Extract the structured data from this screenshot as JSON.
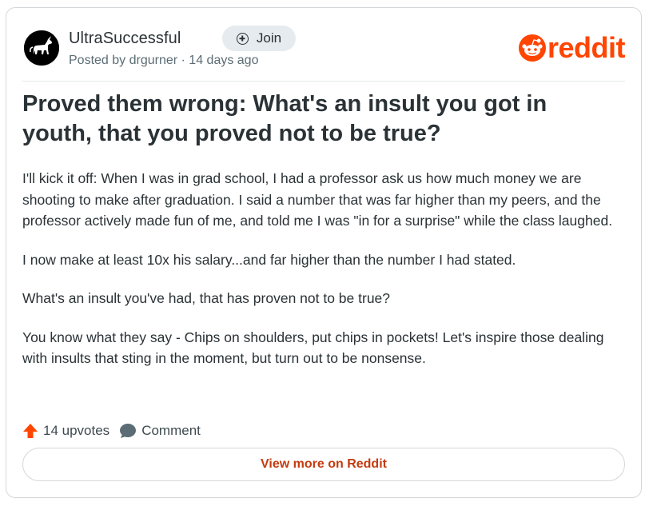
{
  "post": {
    "subreddit": "UltraSuccessful",
    "join_label": "Join",
    "posted_by": "Posted by drgurner · 14 days ago",
    "title": "Proved them wrong: What's an insult you got in youth, that you proved not to be true?",
    "paragraphs": [
      "I'll kick it off: When I was in grad school, I had a professor ask us how much money we are shooting to make after graduation. I said a number that was far higher than my peers, and the professor actively made fun of me, and told me I was \"in for a surprise\" while the class laughed.",
      "I now make at least 10x his salary...and far higher than the number I had stated.",
      "What's an insult you've had, that has proven not to be true?",
      "You know what they say - Chips on shoulders, put chips in pockets! Let's inspire those dealing with insults that sting in the moment, but turn out to be nonsense."
    ],
    "upvotes_label": "14 upvotes",
    "comment_label": "Comment",
    "view_more_label": "View more on Reddit"
  },
  "brand": {
    "logo_text": "reddit",
    "accent_color": "#ff4500",
    "link_color": "#c33b0f"
  },
  "icons": {
    "avatar": "white-unicorn-on-black",
    "join": "plus-circle-icon",
    "logo": "reddit-snoo-icon",
    "upvote": "upvote-arrow-icon",
    "comment": "speech-bubble-icon"
  }
}
